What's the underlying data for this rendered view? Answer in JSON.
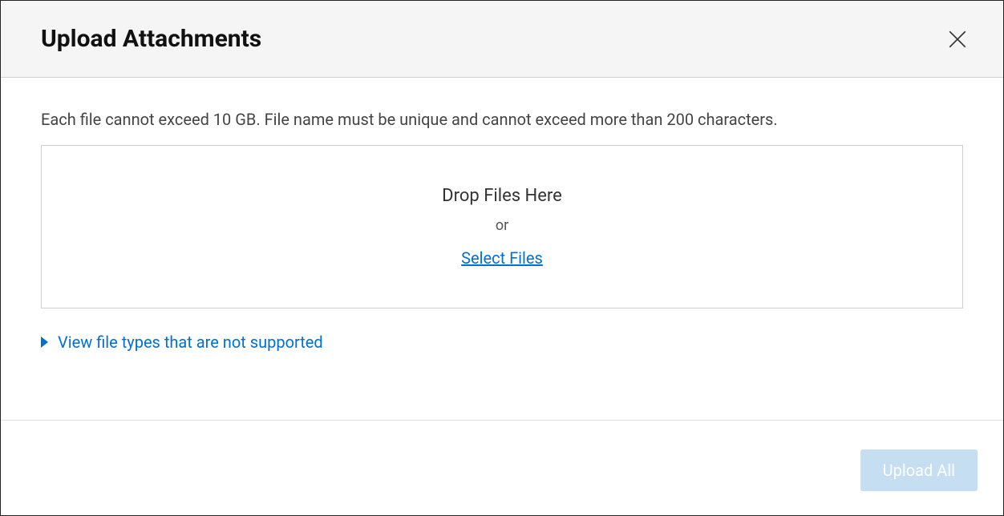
{
  "header": {
    "title": "Upload Attachments"
  },
  "body": {
    "hint": "Each file cannot exceed 10 GB. File name must be unique and cannot exceed more than 200 characters.",
    "dropzone": {
      "title": "Drop Files Here",
      "or": "or",
      "select": "Select Files"
    },
    "expander": {
      "label": "View file types that are not supported"
    }
  },
  "footer": {
    "upload_all": "Upload All"
  }
}
